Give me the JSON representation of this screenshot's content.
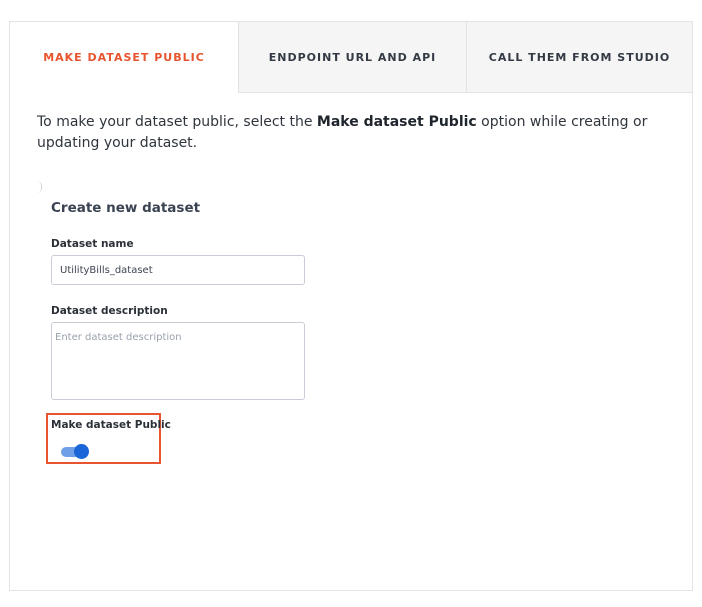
{
  "tabs": [
    {
      "label": "MAKE DATASET PUBLIC",
      "active": true
    },
    {
      "label": "ENDPOINT URL AND API",
      "active": false
    },
    {
      "label": "CALL THEM FROM STUDIO",
      "active": false
    }
  ],
  "intro": {
    "before": "To make your dataset public, select the ",
    "bold": "Make dataset Public",
    "after": " option while creating or updating your dataset."
  },
  "form": {
    "title": "Create new dataset",
    "name_label": "Dataset name",
    "name_value": "UtilityBills_dataset",
    "description_label": "Dataset description",
    "description_placeholder": "Enter dataset description",
    "public_label": "Make dataset Public",
    "public_enabled": true
  },
  "colors": {
    "accent": "#e8542f",
    "toggle_on": "#1a66d9"
  }
}
